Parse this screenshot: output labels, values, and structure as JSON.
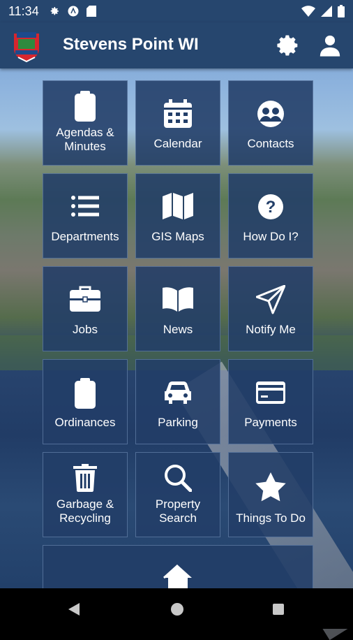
{
  "status_bar": {
    "time": "11:34"
  },
  "app_bar": {
    "title": "Stevens Point WI"
  },
  "tiles": [
    {
      "label": "Agendas & Minutes",
      "icon": "clipboard-icon"
    },
    {
      "label": "Calendar",
      "icon": "calendar-icon"
    },
    {
      "label": "Contacts",
      "icon": "contacts-icon"
    },
    {
      "label": "Departments",
      "icon": "list-icon"
    },
    {
      "label": "GIS Maps",
      "icon": "map-icon"
    },
    {
      "label": "How Do I?",
      "icon": "question-icon"
    },
    {
      "label": "Jobs",
      "icon": "briefcase-icon"
    },
    {
      "label": "News",
      "icon": "book-icon"
    },
    {
      "label": "Notify Me",
      "icon": "send-icon"
    },
    {
      "label": "Ordinances",
      "icon": "clipboard-icon"
    },
    {
      "label": "Parking",
      "icon": "car-icon"
    },
    {
      "label": "Payments",
      "icon": "credit-card-icon"
    },
    {
      "label": "Garbage & Recycling",
      "icon": "trash-icon"
    },
    {
      "label": "Property Search",
      "icon": "search-icon"
    },
    {
      "label": "Things To Do",
      "icon": "star-icon"
    },
    {
      "label": "",
      "icon": "home-icon"
    }
  ]
}
